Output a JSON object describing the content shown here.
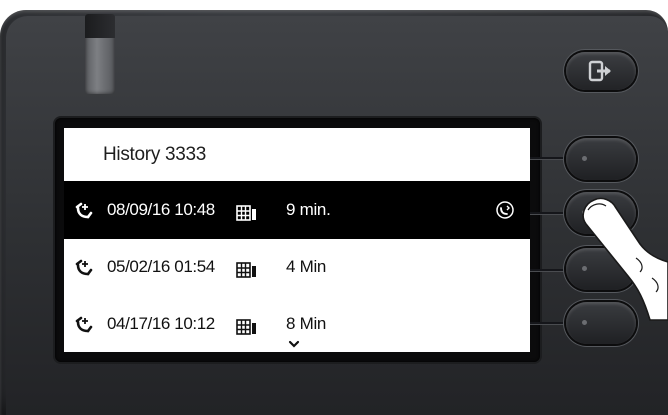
{
  "screen": {
    "title": "History 3333",
    "entries": [
      {
        "date": "08/09/16 10:48",
        "duration": "9 min.",
        "icon": "outgoing-call-icon",
        "type_icon": "business-phonebook-icon",
        "recall_icon": "recall-icon",
        "selected": true
      },
      {
        "date": "05/02/16 01:54",
        "duration": "4 Min",
        "icon": "outgoing-call-icon",
        "type_icon": "business-phonebook-icon",
        "selected": false
      },
      {
        "date": "04/17/16 10:12",
        "duration": "8 Min",
        "icon": "outgoing-call-icon",
        "type_icon": "business-phonebook-icon",
        "selected": false
      }
    ],
    "scroll_icon": "chevron-down-icon"
  },
  "hardware": {
    "exit_icon": "exit-arrow-icon",
    "softkeys": [
      "softkey-1",
      "softkey-2",
      "softkey-3",
      "softkey-4"
    ]
  },
  "colors": {
    "selected_background": "#000000",
    "selected_text": "#ffffff",
    "screen_background": "#ffffff",
    "phone_body": "#35373b"
  }
}
